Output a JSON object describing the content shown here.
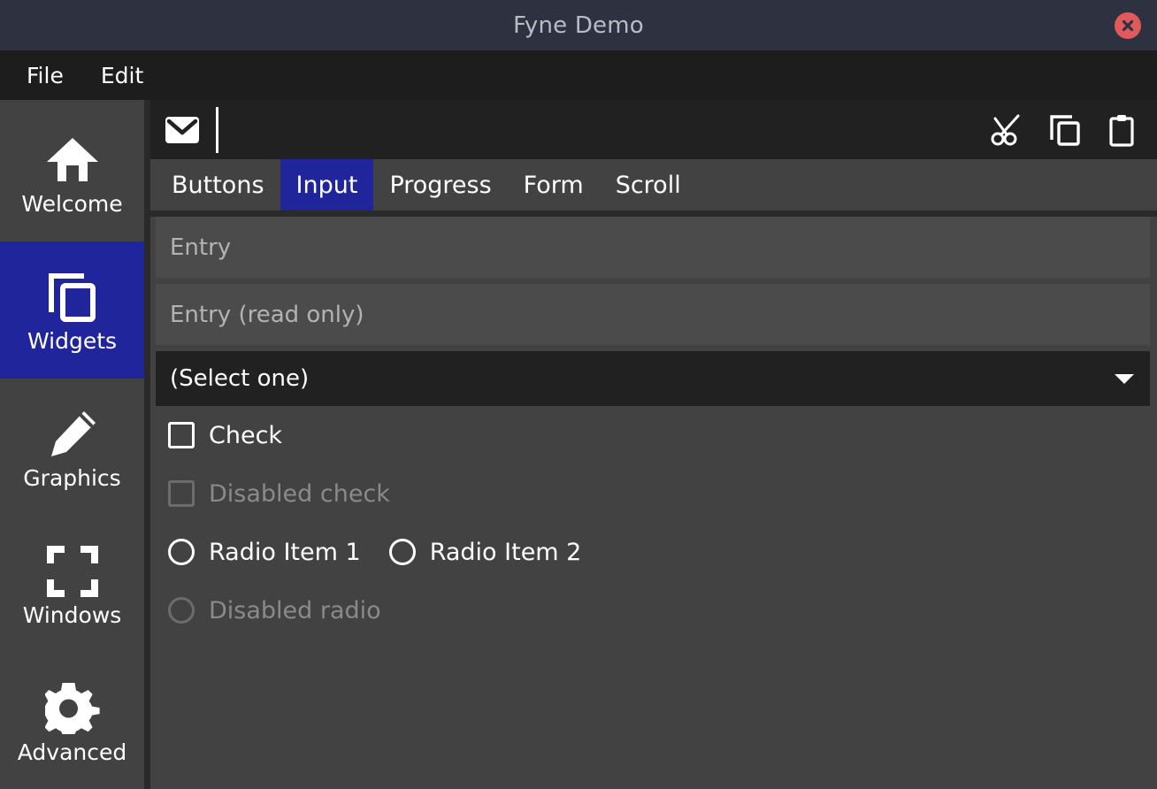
{
  "window": {
    "title": "Fyne Demo",
    "close_icon": "close-circle-icon"
  },
  "menubar": {
    "items": [
      {
        "label": "File"
      },
      {
        "label": "Edit"
      }
    ]
  },
  "sidebar": {
    "items": [
      {
        "label": "Welcome",
        "icon": "home-icon",
        "selected": false
      },
      {
        "label": "Widgets",
        "icon": "copy-icon",
        "selected": true
      },
      {
        "label": "Graphics",
        "icon": "pencil-icon",
        "selected": false
      },
      {
        "label": "Windows",
        "icon": "fullscreen-icon",
        "selected": false
      },
      {
        "label": "Advanced",
        "icon": "gear-icon",
        "selected": false
      }
    ]
  },
  "toolbar": {
    "left": [
      {
        "name": "mail-icon",
        "label": "Mail"
      }
    ],
    "right": [
      {
        "name": "cut-icon",
        "label": "Cut"
      },
      {
        "name": "copy-icon",
        "label": "Copy"
      },
      {
        "name": "paste-icon",
        "label": "Paste"
      }
    ]
  },
  "tabs": [
    {
      "label": "Buttons",
      "active": false
    },
    {
      "label": "Input",
      "active": true
    },
    {
      "label": "Progress",
      "active": false
    },
    {
      "label": "Form",
      "active": false
    },
    {
      "label": "Scroll",
      "active": false
    }
  ],
  "input_tab": {
    "entry": {
      "value": "",
      "placeholder": "Entry"
    },
    "entry_readonly": {
      "value": "",
      "placeholder": "Entry (read only)"
    },
    "select": {
      "value": "(Select one)",
      "caret_icon": "chevron-down-icon"
    },
    "check": {
      "label": "Check",
      "checked": false,
      "disabled": false
    },
    "check_disabled": {
      "label": "Disabled check",
      "checked": false,
      "disabled": true
    },
    "radio_group": [
      {
        "label": "Radio Item 1",
        "selected": false
      },
      {
        "label": "Radio Item 2",
        "selected": false
      }
    ],
    "radio_disabled": {
      "label": "Disabled radio",
      "selected": false,
      "disabled": true
    }
  },
  "colors": {
    "titlebar_bg": "#2e3240",
    "menubar_bg": "#1d1d1d",
    "main_bg": "#424242",
    "accent_selected": "#20259c",
    "toolbar_bg": "#212121",
    "entry_bg": "#4b4b4b",
    "close_button": "#e05a5c",
    "text_primary": "#ffffff",
    "text_muted": "#8a8a8a",
    "title_text": "#b9bcc7"
  }
}
